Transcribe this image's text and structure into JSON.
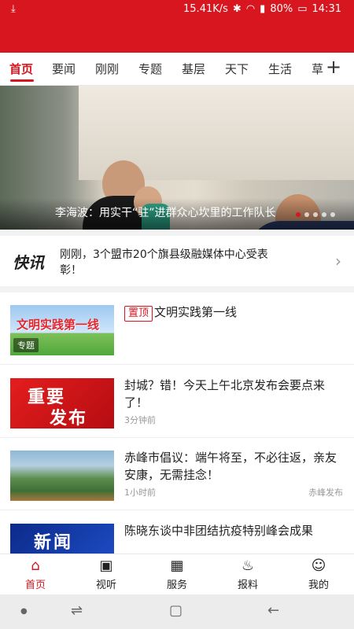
{
  "status_bar": {
    "speed": "15.41K/s",
    "battery": "80%",
    "time": "14:31"
  },
  "tabs": [
    "首页",
    "要闻",
    "刚刚",
    "专题",
    "基层",
    "天下",
    "生活",
    "草"
  ],
  "banner": {
    "caption": "李海波：用实干“驻”进群众心坎里的工作队长"
  },
  "kuaixun": {
    "logo": "快讯",
    "text": "刚刚，3个盟市20个旗县级融媒体中心受表彰！"
  },
  "news": [
    {
      "pinned_label": "置顶",
      "title": "文明实践第一线",
      "thumb_text": "文明实践第一线",
      "tag": "专题",
      "time": "",
      "source": ""
    },
    {
      "title": "封城？错！今天上午北京发布会要点来了！",
      "thumb_text_1": "重要",
      "thumb_text_2": "发布",
      "time": "3分钟前",
      "source": ""
    },
    {
      "title": "赤峰市倡议：端午将至，不必往返，亲友安康，无需挂念！",
      "time": "1小时前",
      "source": "赤峰发布"
    },
    {
      "title": "陈晓东谈中非团结抗疫特别峰会成果",
      "thumb_text": "新闻",
      "time": "",
      "source": ""
    }
  ],
  "bottom_nav": [
    {
      "label": "首页",
      "icon": "home-icon"
    },
    {
      "label": "视听",
      "icon": "tv-icon"
    },
    {
      "label": "服务",
      "icon": "grid-icon"
    },
    {
      "label": "报料",
      "icon": "fire-icon"
    },
    {
      "label": "我的",
      "icon": "user-icon"
    }
  ],
  "colors": {
    "brand": "#d7161f"
  }
}
